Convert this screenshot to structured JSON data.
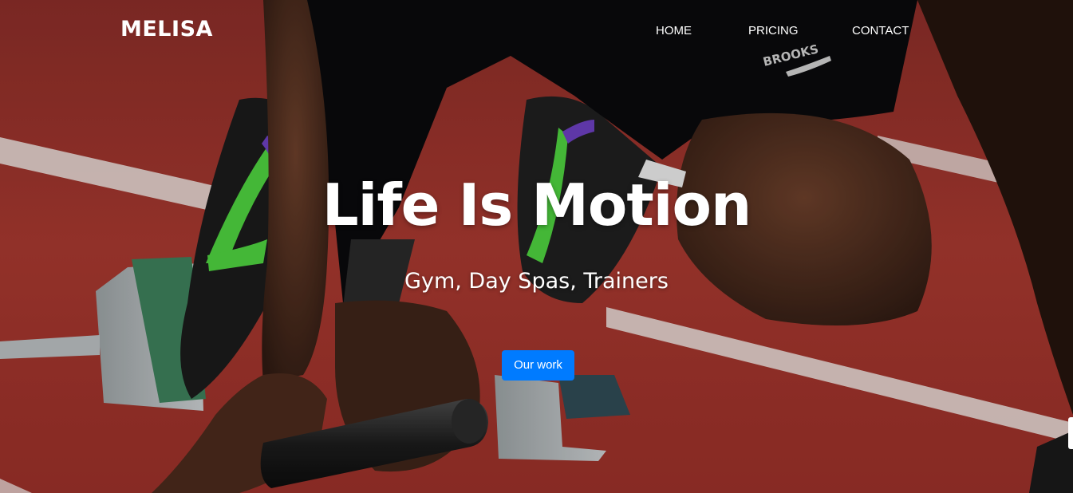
{
  "brand": {
    "name": "MELISA"
  },
  "nav": {
    "items": [
      {
        "label": "HOME"
      },
      {
        "label": "PRICING"
      },
      {
        "label": "CONTACT"
      }
    ]
  },
  "hero": {
    "title": "Life Is Motion",
    "subtitle": "Gym, Day Spas, Trainers",
    "cta_label": "Our work",
    "background_image_text": "BROOKS"
  },
  "colors": {
    "accent": "#007bff",
    "track": "#a8362f",
    "text": "#ffffff"
  },
  "icons": {
    "background": "running-track-photo"
  }
}
